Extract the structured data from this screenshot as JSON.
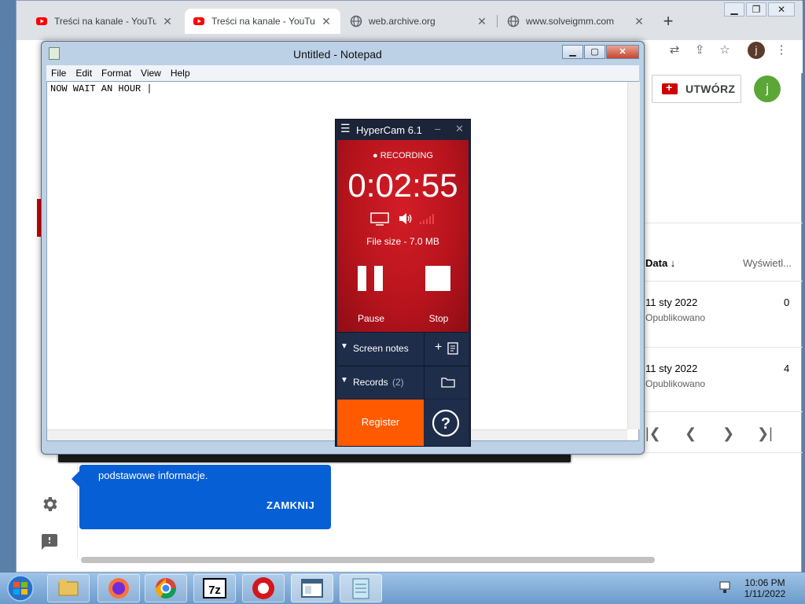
{
  "browser": {
    "tabs": [
      {
        "label": "Treści na kanale - YouTube",
        "favicon": "youtube-icon",
        "active": false
      },
      {
        "label": "Treści na kanale - YouTube",
        "favicon": "youtube-icon",
        "active": true
      },
      {
        "label": "web.archive.org",
        "favicon": "globe-icon",
        "active": false
      },
      {
        "label": "www.solveigmm.com",
        "favicon": "globe-icon",
        "active": false
      }
    ],
    "new_tab": "+",
    "profile_initial": "j"
  },
  "youtube": {
    "create_label": "UTWÓRZ",
    "avatar_initial": "j",
    "columns": {
      "date": "Data ↓",
      "views": "Wyświetl..."
    },
    "rows": [
      {
        "date": "11 sty 2022",
        "status": "Opublikowano",
        "views": "0"
      },
      {
        "date": "11 sty 2022",
        "status": "Opublikowano",
        "views": "4"
      }
    ],
    "pager": [
      "|❮",
      "❮",
      "❯",
      "❯|"
    ],
    "tooltip": {
      "text": "podstawowe informacje.",
      "close": "ZAMKNIJ"
    }
  },
  "notepad": {
    "title": "Untitled - Notepad",
    "menu": [
      "File",
      "Edit",
      "Format",
      "View",
      "Help"
    ],
    "content": "NOW WAIT AN HOUR |"
  },
  "hypercam": {
    "title": "HyperCam 6.1",
    "status": "RECORDING",
    "timer": "0:02:55",
    "file_size": "File size - 7.0 MB",
    "pause_label": "Pause",
    "stop_label": "Stop",
    "screen_notes": "Screen notes",
    "records": "Records",
    "records_count": "(2)",
    "register": "Register",
    "colors": {
      "red": "#c8161f",
      "navy": "#17253d",
      "orange": "#ff5a00"
    }
  },
  "taskbar": {
    "apps": [
      "explorer-icon",
      "firefox-icon",
      "chrome-icon",
      "7zip-icon",
      "hypercam-icon",
      "window-icon",
      "notepad-icon"
    ],
    "time": "10:06 PM",
    "date": "1/11/2022"
  }
}
